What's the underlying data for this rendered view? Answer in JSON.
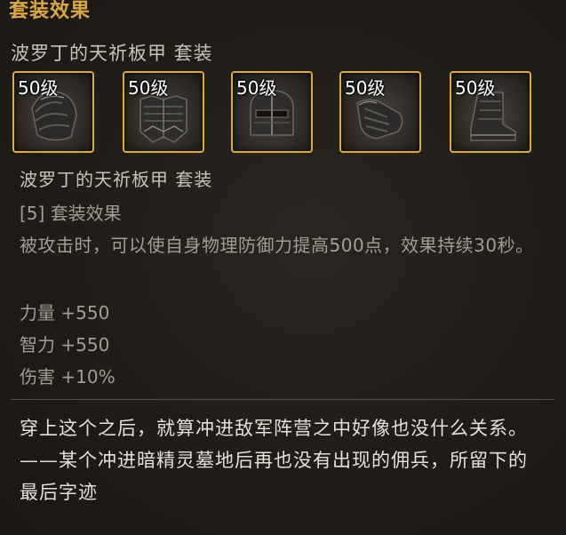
{
  "header": {
    "title": "套装效果",
    "set_name": "波罗丁的天祈板甲  套装"
  },
  "slots": [
    {
      "level": "50级",
      "icon": "shoulder-armor-icon"
    },
    {
      "level": "50级",
      "icon": "chest-armor-icon"
    },
    {
      "level": "50级",
      "icon": "helmet-armor-icon"
    },
    {
      "level": "50级",
      "icon": "gauntlet-armor-icon"
    },
    {
      "level": "50级",
      "icon": "boots-armor-icon"
    }
  ],
  "details": {
    "set_name": "波罗丁的天祈板甲  套装",
    "effect_title": "[5] 套装效果",
    "effect_description": "被攻击时，可以使自身物理防御力提高500点，效果持续30秒。",
    "stats": [
      "力量 +550",
      "智力 +550",
      "伤害 +10%"
    ]
  },
  "flavor_text": "穿上这个之后，就算冲进敌军阵营之中好像也没什么关系。 ——某个冲进暗精灵墓地后再也没有出现的佣兵，所留下的最后字迹",
  "colors": {
    "header": "#d9a64a",
    "slot_border": "#d9ab46",
    "text_primary": "#c9c2b6",
    "text_secondary": "#a39d92",
    "flavor": "#e6e1d8"
  }
}
